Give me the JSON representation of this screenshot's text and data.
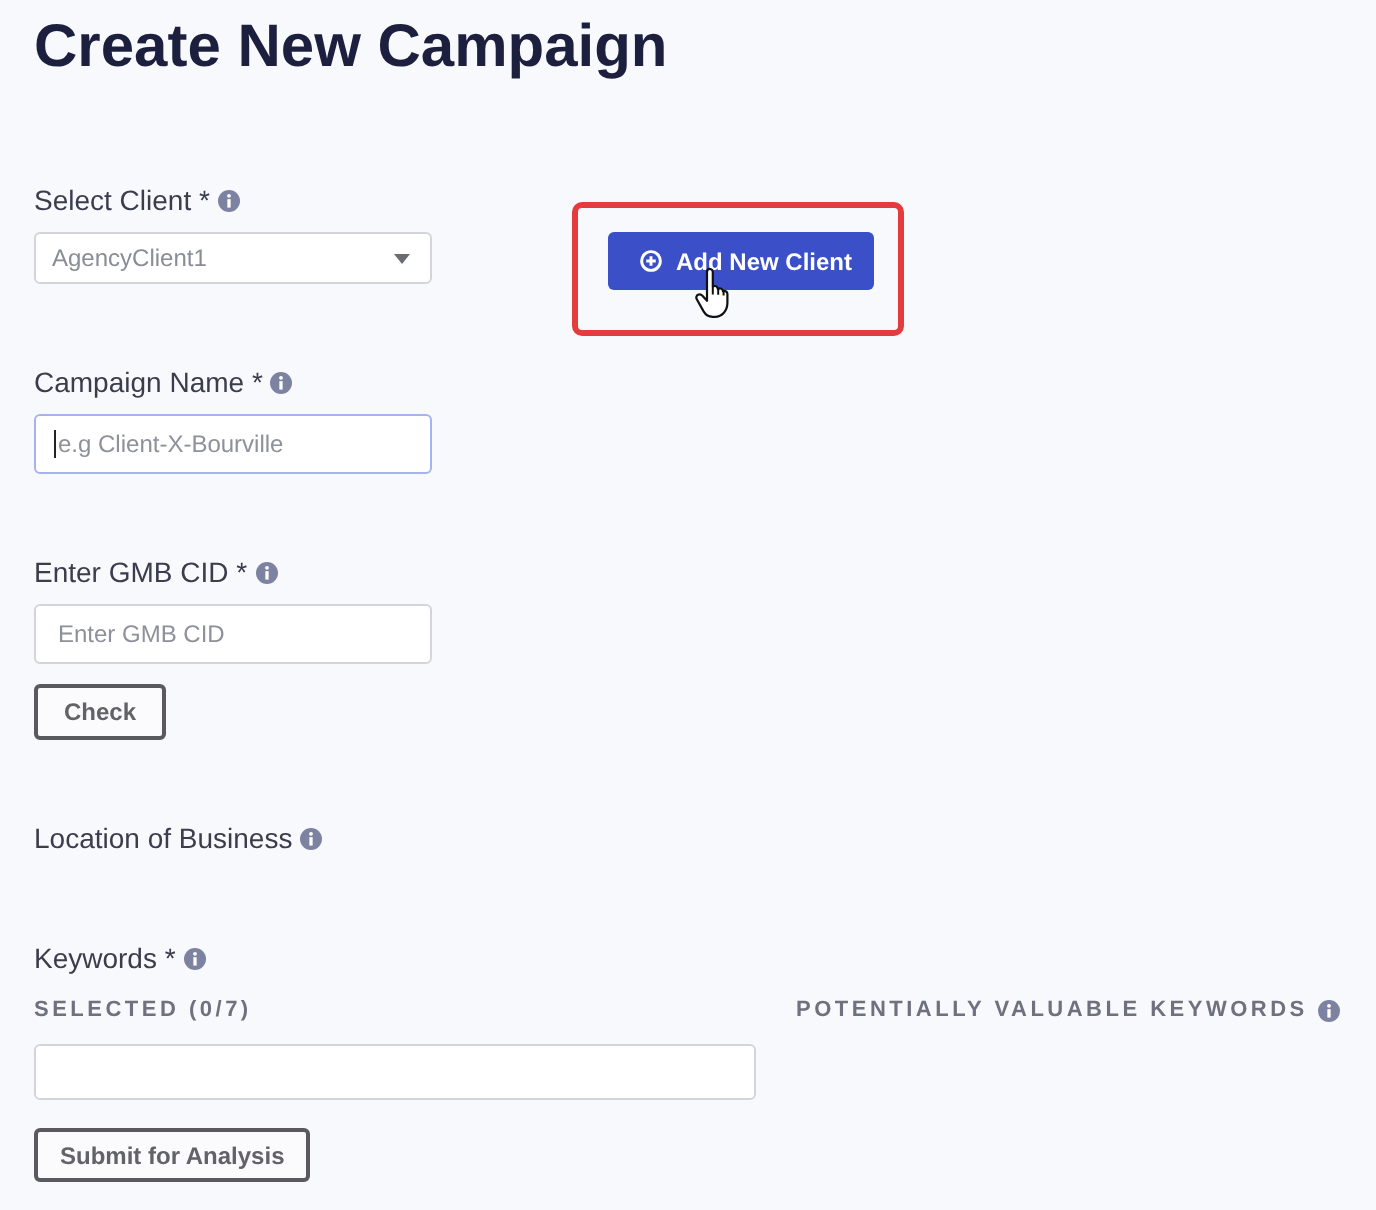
{
  "page": {
    "title": "Create New Campaign"
  },
  "sections": [
    {
      "kind": "select",
      "label": "Select Client *",
      "value": "AgencyClient1",
      "action": {
        "label": "Add New Client",
        "highlighted": true
      }
    },
    {
      "kind": "text",
      "label": "Campaign Name *",
      "placeholder": "e.g Client-X-Bourville",
      "focused": true
    },
    {
      "kind": "text",
      "label": "Enter GMB CID *",
      "placeholder": "Enter GMB CID",
      "focused": false,
      "button": "Check"
    },
    {
      "kind": "heading",
      "label": "Location of Business"
    },
    {
      "kind": "keywords",
      "label": "Keywords *",
      "selected_label": "SELECTED (0/7)",
      "suggestions_label": "POTENTIALLY VALUABLE KEYWORDS",
      "button": "Submit for Analysis"
    }
  ]
}
